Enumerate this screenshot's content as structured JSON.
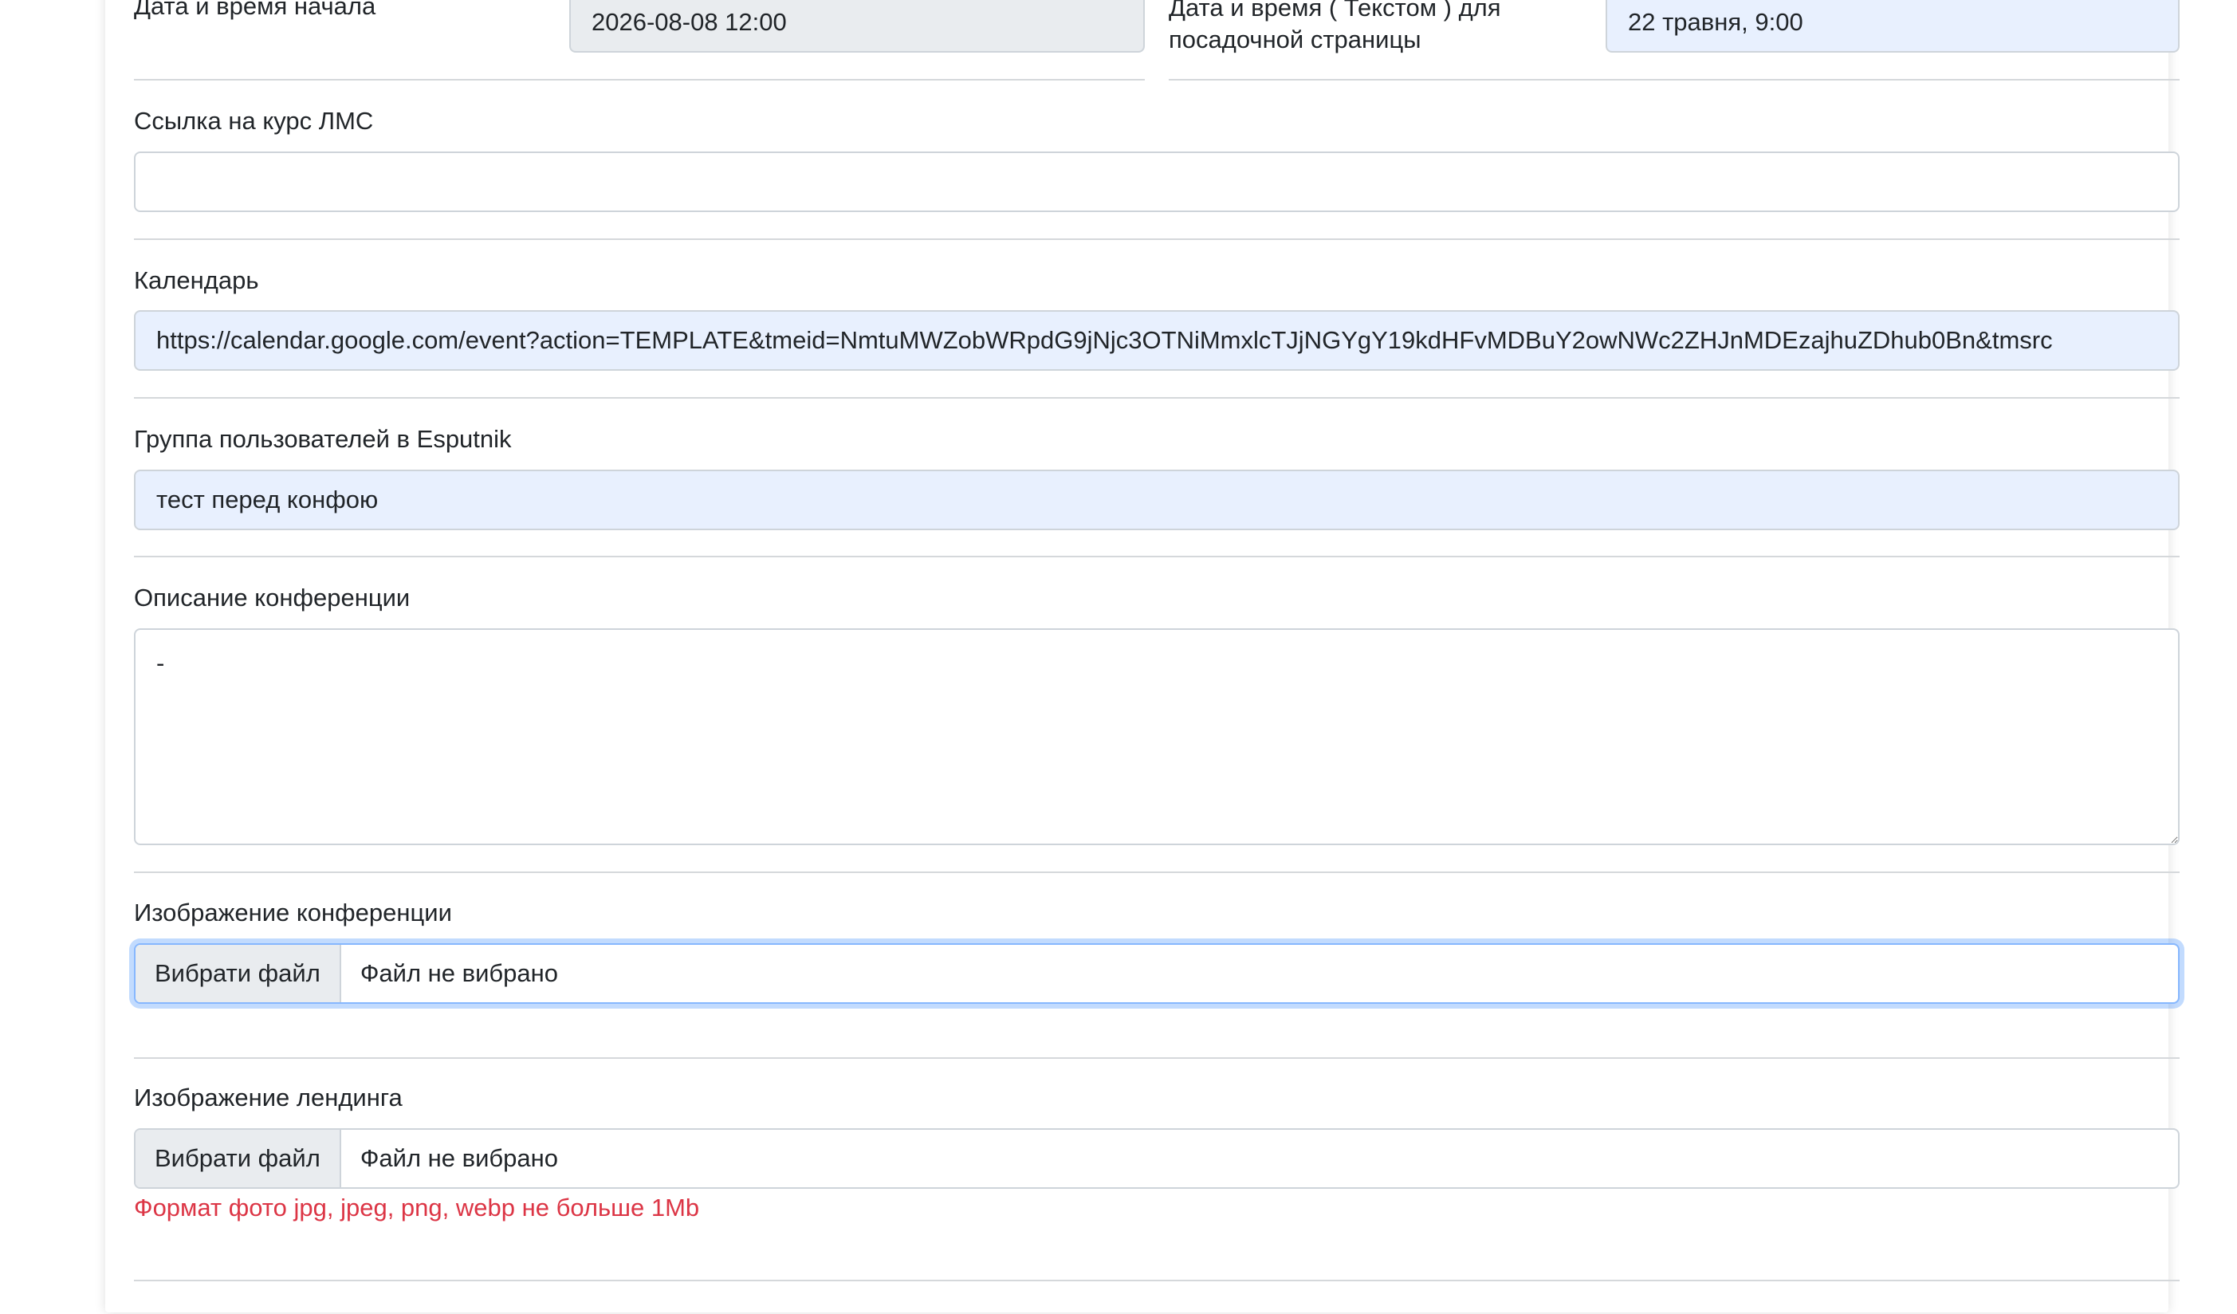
{
  "start": {
    "label": "Дата и время начала",
    "value": "2026-08-08 12:00"
  },
  "landing_time": {
    "label": "Дата и время ( Текстом ) для посадочной страницы",
    "value": "22 травня, 9:00"
  },
  "lms": {
    "label": "Ссылка на курс ЛМС",
    "value": ""
  },
  "calendar": {
    "label": "Календарь",
    "value": "https://calendar.google.com/event?action=TEMPLATE&tmeid=NmtuMWZobWRpdG9jNjc3OTNiMmxlcTJjNGYgY19kdHFvMDBuY2owNWc2ZHJnMDEzajhuZDhub0Bn&tmsrc"
  },
  "esputnik": {
    "label": "Группа пользователей в Esputnik",
    "value": "тест перед конфою"
  },
  "description": {
    "label": "Описание конференции",
    "value": "-"
  },
  "conf_image": {
    "label": "Изображение конференции",
    "button": "Вибрати файл",
    "status": "Файл не вибрано"
  },
  "landing_image": {
    "label": "Изображение лендинга",
    "button": "Вибрати файл",
    "status": "Файл не вибрано",
    "hint": "Формат фото jpg, jpeg, png, webp не больше 1Mb"
  },
  "colors": {
    "error": "#dc3545",
    "autofill": "#e8f0fe",
    "readonly": "#e9ecef",
    "focus": "#86b7fe"
  }
}
